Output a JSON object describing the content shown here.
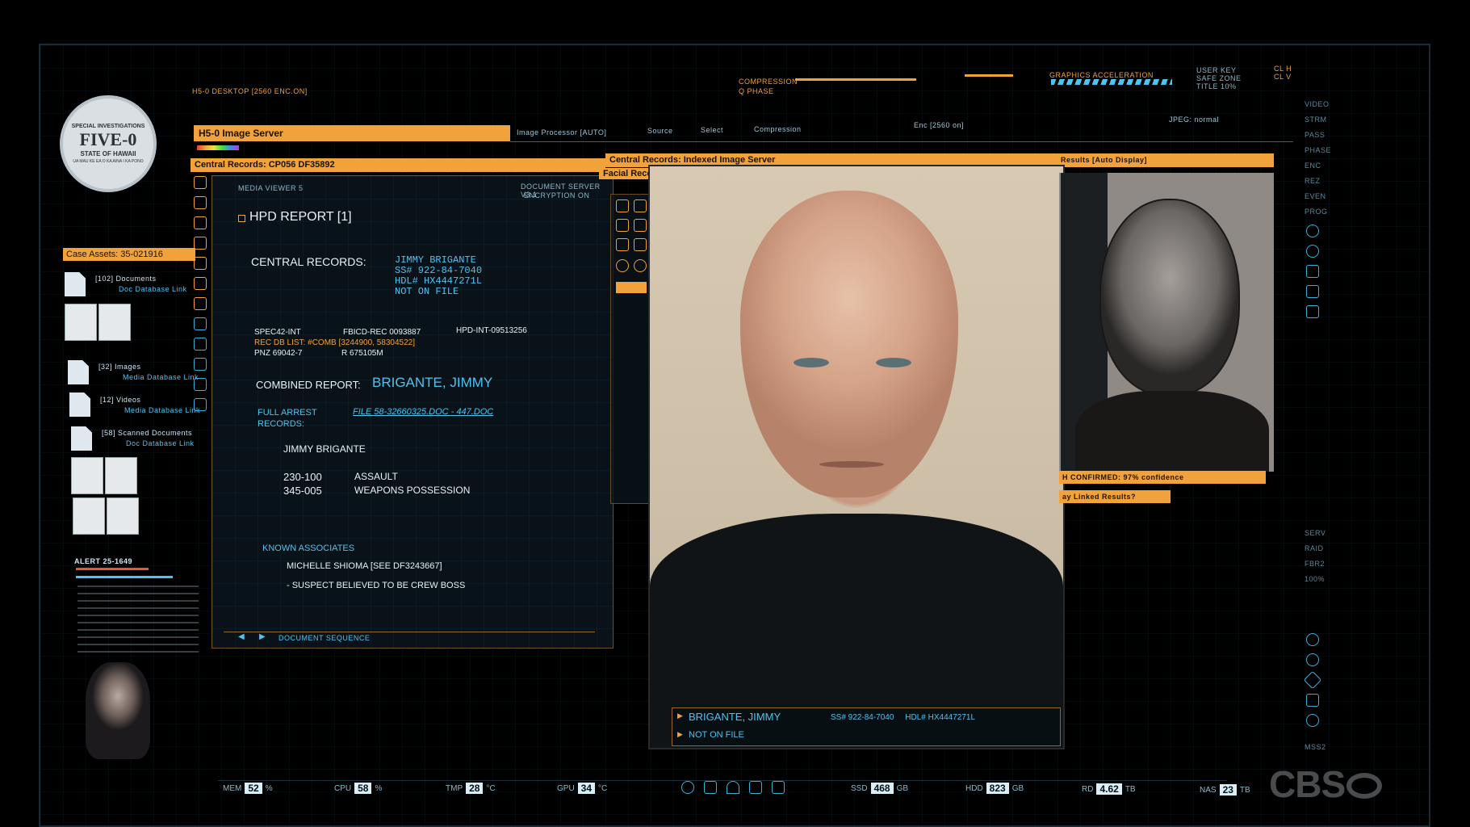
{
  "top_strip": {
    "desktop_label": "H5-0 DESKTOP [2560 ENC.ON]",
    "compression": "COMPRESSION",
    "q_phase": "Q PHASE",
    "graphics": "GRAPHICS ACCELERATION",
    "user_key": "USER KEY",
    "safe_zone": "SAFE ZONE",
    "title_pct": "TITLE 10%",
    "cl_h": "CL H",
    "cl_v": "CL V"
  },
  "logo": {
    "ring_text": "SPECIAL INVESTIGATIONS",
    "main": "FIVE-0",
    "sub": "STATE OF HAWAII",
    "bottom": "UA MAU KE EA O KA AINA I KA PONO"
  },
  "image_server": {
    "title": "H5-0 Image Server",
    "processor": "Image Processor [AUTO]",
    "source": "Source",
    "select": "Select",
    "compression": "Compression",
    "enc": "Enc [2560 on]",
    "jpeg": "JPEG: normal"
  },
  "central_records_bar": "Central Records: CP056 DF35892",
  "case_assets": {
    "header": "Case Assets: 35-021916",
    "items": [
      {
        "label": "[102] Documents",
        "link": "Doc Database Link"
      },
      {
        "label": "[32] Images",
        "link": "Media Database Link"
      },
      {
        "label": "[12] Videos",
        "link": "Media Database Link"
      },
      {
        "label": "[58] Scanned Documents",
        "link": "Doc Database Link"
      }
    ],
    "alert_title": "ALERT 25-1649"
  },
  "media_viewer": {
    "label": "MEDIA VIEWER 5",
    "doc_server": "DOCUMENT SERVER V3.1",
    "encryption": "ENCRYPTION ON",
    "doc_sequence": "DOCUMENT SEQUENCE"
  },
  "report": {
    "title": "HPD REPORT [1]",
    "central_label": "CENTRAL RECORDS:",
    "central_lines": [
      "JIMMY BRIGANTE",
      "SS# 922-84-7040",
      "HDL# HX4447271L",
      "NOT ON FILE"
    ],
    "spec": "SPEC42-INT",
    "fbicd": "FBICD-REC 0093887",
    "hpd_int": "HPD-INT-09513256",
    "rec_list": "REC DB LIST: #COMB [3244900, 58304522]",
    "pnz": "PNZ 69042-7",
    "r_code": "R 675105M",
    "combined_label": "COMBINED REPORT:",
    "combined_name": "BRIGANTE, JIMMY",
    "arrest_label_1": "FULL ARREST",
    "arrest_label_2": "RECORDS:",
    "arrest_file": "FILE 58-32660325.DOC - 447.DOC",
    "person": "JIMMY BRIGANTE",
    "charges": [
      {
        "code": "230-100",
        "desc": "ASSAULT"
      },
      {
        "code": "345-005",
        "desc": "WEAPONS POSSESSION"
      }
    ],
    "associates_label": "KNOWN ASSOCIATES",
    "associate": "MICHELLE SHIOMA [SEE DF3243667]",
    "note": "- SUSPECT BELIEVED TO BE CREW BOSS"
  },
  "indexed_server": {
    "title": "Central Records: Indexed Image Server",
    "module": "Facial Recognition Module",
    "results": "Results [Auto Display]"
  },
  "photo_caption": {
    "name": "BRIGANTE, JIMMY",
    "ids": "SS# 922-84-7040     HDL# HX4447271L",
    "status": "NOT ON FILE"
  },
  "match": {
    "confirmed": "H CONFIRMED: 97% confidence",
    "linked": "ay Linked Results?"
  },
  "right_rail": [
    "VIDEO",
    "STRM",
    "PASS",
    "PHASE",
    "ENC",
    "REZ",
    "EVEN",
    "PROG",
    "SERV",
    "RAID",
    "FBR2",
    "100%",
    "MSS2"
  ],
  "stats": [
    {
      "label": "MEM",
      "value": "52",
      "unit": "%"
    },
    {
      "label": "CPU",
      "value": "58",
      "unit": "%"
    },
    {
      "label": "TMP",
      "value": "28",
      "unit": "°C"
    },
    {
      "label": "GPU",
      "value": "34",
      "unit": "°C"
    },
    {
      "label": "SSD",
      "value": "468",
      "unit": "GB"
    },
    {
      "label": "HDD",
      "value": "823",
      "unit": "GB"
    },
    {
      "label": "RD",
      "value": "4.62",
      "unit": "TB"
    },
    {
      "label": "NAS",
      "value": "23",
      "unit": "TB"
    }
  ],
  "watermark": "CBS"
}
